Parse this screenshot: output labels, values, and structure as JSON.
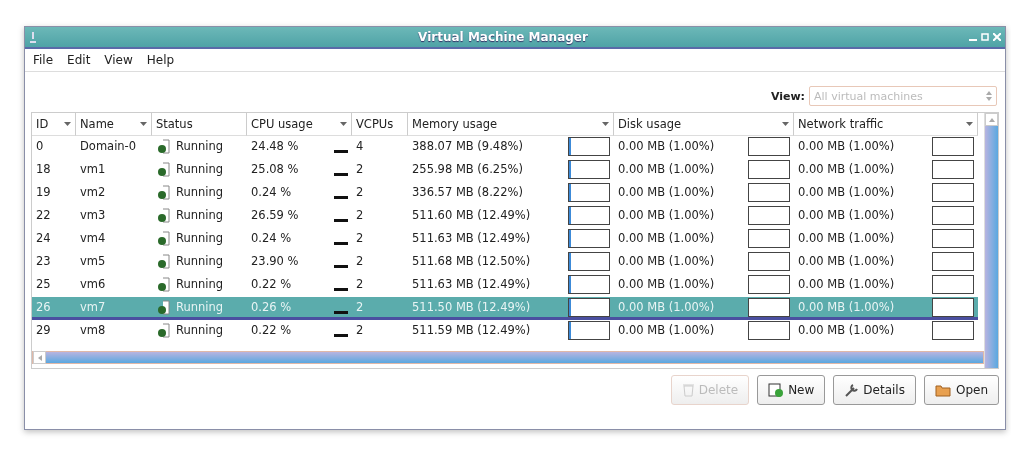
{
  "window": {
    "title": "Virtual Machine Manager"
  },
  "menu": [
    "File",
    "Edit",
    "View",
    "Help"
  ],
  "view_filter": {
    "label": "View:",
    "placeholder": "All virtual machines"
  },
  "table": {
    "columns": [
      {
        "label": "ID",
        "sortable": true
      },
      {
        "label": "Name",
        "sortable": true
      },
      {
        "label": "Status",
        "sortable": false
      },
      {
        "label": "CPU usage",
        "sortable": true
      },
      {
        "label": "VCPUs",
        "sortable": false
      },
      {
        "label": "Memory usage",
        "sortable": true
      },
      {
        "label": "Disk usage",
        "sortable": true
      },
      {
        "label": "Network traffic",
        "sortable": true
      }
    ],
    "rows": [
      {
        "id": "0",
        "name": "Domain-0",
        "status": "Running",
        "cpu": "24.48 %",
        "vcpus": "4",
        "memory": "388.07 MB (9.48%)",
        "disk": "0.00 MB (1.00%)",
        "network": "0.00 MB (1.00%)",
        "selected": false
      },
      {
        "id": "18",
        "name": "vm1",
        "status": "Running",
        "cpu": "25.08 %",
        "vcpus": "2",
        "memory": "255.98 MB (6.25%)",
        "disk": "0.00 MB (1.00%)",
        "network": "0.00 MB (1.00%)",
        "selected": false
      },
      {
        "id": "19",
        "name": "vm2",
        "status": "Running",
        "cpu": "0.24 %",
        "vcpus": "2",
        "memory": "336.57 MB (8.22%)",
        "disk": "0.00 MB (1.00%)",
        "network": "0.00 MB (1.00%)",
        "selected": false
      },
      {
        "id": "22",
        "name": "vm3",
        "status": "Running",
        "cpu": "26.59 %",
        "vcpus": "2",
        "memory": "511.60 MB (12.49%)",
        "disk": "0.00 MB (1.00%)",
        "network": "0.00 MB (1.00%)",
        "selected": false
      },
      {
        "id": "24",
        "name": "vm4",
        "status": "Running",
        "cpu": "0.24 %",
        "vcpus": "2",
        "memory": "511.63 MB (12.49%)",
        "disk": "0.00 MB (1.00%)",
        "network": "0.00 MB (1.00%)",
        "selected": false
      },
      {
        "id": "23",
        "name": "vm5",
        "status": "Running",
        "cpu": "23.90 %",
        "vcpus": "2",
        "memory": "511.68 MB (12.50%)",
        "disk": "0.00 MB (1.00%)",
        "network": "0.00 MB (1.00%)",
        "selected": false
      },
      {
        "id": "25",
        "name": "vm6",
        "status": "Running",
        "cpu": "0.22 %",
        "vcpus": "2",
        "memory": "511.63 MB (12.49%)",
        "disk": "0.00 MB (1.00%)",
        "network": "0.00 MB (1.00%)",
        "selected": false
      },
      {
        "id": "26",
        "name": "vm7",
        "status": "Running",
        "cpu": "0.26 %",
        "vcpus": "2",
        "memory": "511.50 MB (12.49%)",
        "disk": "0.00 MB (1.00%)",
        "network": "0.00 MB (1.00%)",
        "selected": true
      },
      {
        "id": "29",
        "name": "vm8",
        "status": "Running",
        "cpu": "0.22 %",
        "vcpus": "2",
        "memory": "511.59 MB (12.49%)",
        "disk": "0.00 MB (1.00%)",
        "network": "0.00 MB (1.00%)",
        "selected": false
      }
    ]
  },
  "buttons": [
    {
      "label": "Delete",
      "kind": "delete",
      "disabled": true
    },
    {
      "label": "New",
      "kind": "new",
      "disabled": false
    },
    {
      "label": "Details",
      "kind": "details",
      "disabled": false
    },
    {
      "label": "Open",
      "kind": "open",
      "disabled": false
    }
  ]
}
